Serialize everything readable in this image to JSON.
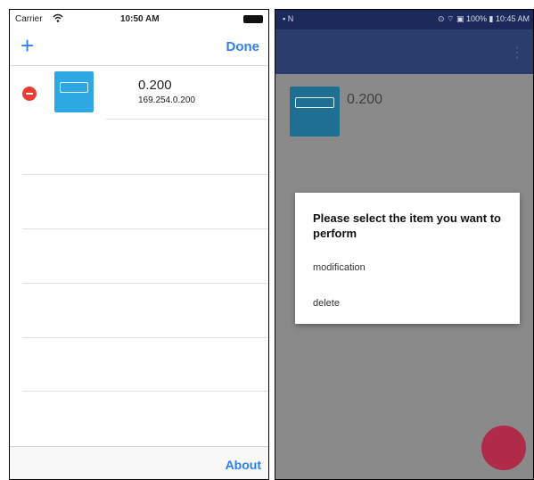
{
  "ios": {
    "status": {
      "carrier": "Carrier",
      "time": "10:50 AM"
    },
    "nav": {
      "add_label": "+",
      "done_label": "Done"
    },
    "device": {
      "name": "0.200",
      "ip": "169.254.0.200"
    },
    "toolbar": {
      "about_label": "About"
    }
  },
  "android": {
    "status": {
      "left": "▪ N",
      "battery_time": "⊙ ⌔ ▣ 100% ▮ 10:45 AM"
    },
    "device": {
      "name": "0.200"
    },
    "dialog": {
      "title": "Please select the item you want to perform",
      "options": [
        "modification",
        "delete"
      ]
    },
    "more_menu": "⋮"
  },
  "colors": {
    "ios_accent": "#2f80ed",
    "delete_red": "#ec3c33",
    "device_blue": "#2ea8e3",
    "android_bar": "#2b3d6d",
    "fab": "#b02a4a"
  }
}
